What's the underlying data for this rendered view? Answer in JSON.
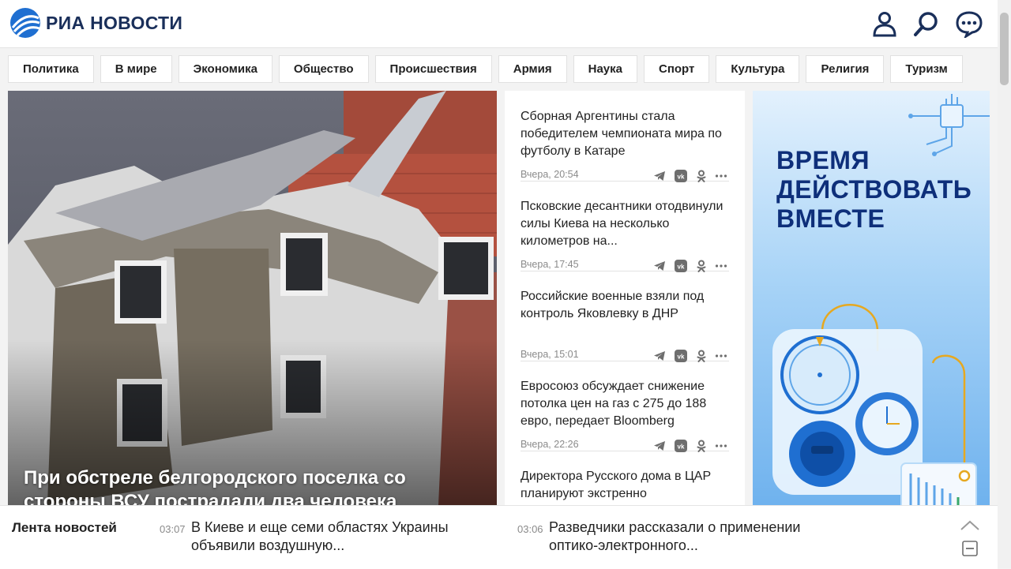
{
  "header": {
    "logo_text": "РИА НОВОСТИ",
    "icons": [
      "user-icon",
      "search-icon",
      "chat-icon"
    ]
  },
  "rubrics": [
    "Политика",
    "В мире",
    "Экономика",
    "Общество",
    "Происшествия",
    "Армия",
    "Наука",
    "Спорт",
    "Культура",
    "Религия",
    "Туризм"
  ],
  "main": {
    "title": "При обстреле белгородского поселка со стороны ВСУ пострадали два человека"
  },
  "news": [
    {
      "title": "Сборная Аргентины стала победителем чемпионата мира по футболу в Катаре",
      "time": "Вчера, 20:54"
    },
    {
      "title": "Псковские десантники отодвинули силы Киева на несколько километров на...",
      "time": "Вчера, 17:45"
    },
    {
      "title": "Российские военные взяли под контроль Яковлевку в ДНР",
      "time": "Вчера, 15:01"
    },
    {
      "title": "Евросоюз обсуждает снижение потолка цен на газ с 275 до 188 евро, передает Bloomberg",
      "time": "Вчера, 22:26"
    },
    {
      "title": "Директора Русского дома в ЦАР планируют экстренно",
      "time": ""
    }
  ],
  "ad": {
    "line1": "ВРЕМЯ",
    "line2": "ДЕЙСТВОВАТЬ",
    "line3": "ВМЕСТЕ"
  },
  "feed": {
    "label": "Лента новостей",
    "items": [
      {
        "time": "03:07",
        "text": "В Киеве и еще семи областях Украины объявили воздушную..."
      },
      {
        "time": "03:06",
        "text": "Разведчики рассказали о применении оптико-электронного..."
      }
    ]
  },
  "colors": {
    "brand": "#1a2f5a",
    "accent": "#1f6fd1",
    "ad_bg": "#8ec6f5",
    "ad_text": "#0e2f7a"
  }
}
